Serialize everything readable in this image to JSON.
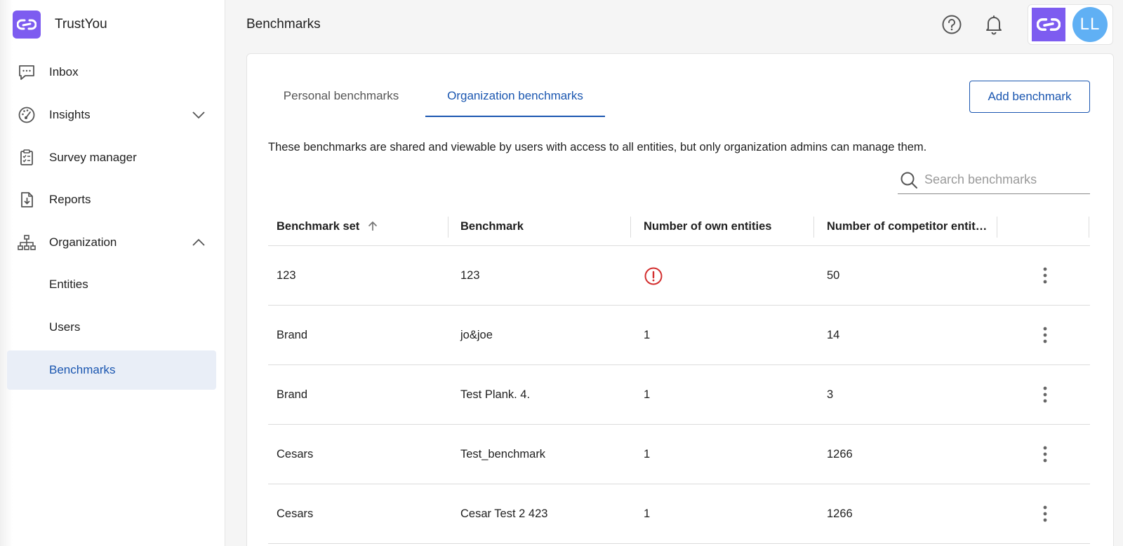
{
  "app": {
    "name": "TrustYou",
    "brand_color": "#7d5cf0",
    "accent_color": "#1a56b0"
  },
  "sidebar": {
    "items": [
      {
        "label": "Inbox",
        "icon": "chat-icon"
      },
      {
        "label": "Insights",
        "icon": "dashboard-gauge-icon",
        "chevron": "chevron-down-icon"
      },
      {
        "label": "Survey manager",
        "icon": "clipboard-icon"
      },
      {
        "label": "Reports",
        "icon": "file-download-icon"
      },
      {
        "label": "Organization",
        "icon": "hierarchy-icon",
        "chevron": "chevron-up-icon"
      },
      {
        "label": "Entities"
      },
      {
        "label": "Users"
      },
      {
        "label": "Benchmarks",
        "active": true
      }
    ]
  },
  "header": {
    "title": "Benchmarks",
    "avatar_initials": "LL"
  },
  "tabs": [
    {
      "label": "Personal benchmarks",
      "active": false
    },
    {
      "label": "Organization benchmarks",
      "active": true
    }
  ],
  "add_button": "Add benchmark",
  "description": "These benchmarks are shared and viewable by users with access to all entities, but only organization admins can manage them.",
  "search": {
    "placeholder": "Search benchmarks",
    "value": ""
  },
  "table": {
    "columns": [
      "Benchmark set",
      "Benchmark",
      "Number of own entities",
      "Number of competitor entit…"
    ],
    "sort_column": "Benchmark set",
    "sort_direction": "ascending",
    "rows": [
      {
        "set": "123",
        "benchmark": "123",
        "own": "",
        "own_warning": true,
        "competitors": "50"
      },
      {
        "set": "Brand",
        "benchmark": "jo&joe",
        "own": "1",
        "own_warning": false,
        "competitors": "14"
      },
      {
        "set": "Brand",
        "benchmark": "Test Plank. 4.",
        "own": "1",
        "own_warning": false,
        "competitors": "3"
      },
      {
        "set": "Cesars",
        "benchmark": "Test_benchmark",
        "own": "1",
        "own_warning": false,
        "competitors": "1266"
      },
      {
        "set": "Cesars",
        "benchmark": "Cesar Test 2 423",
        "own": "1",
        "own_warning": false,
        "competitors": "1266"
      }
    ]
  }
}
